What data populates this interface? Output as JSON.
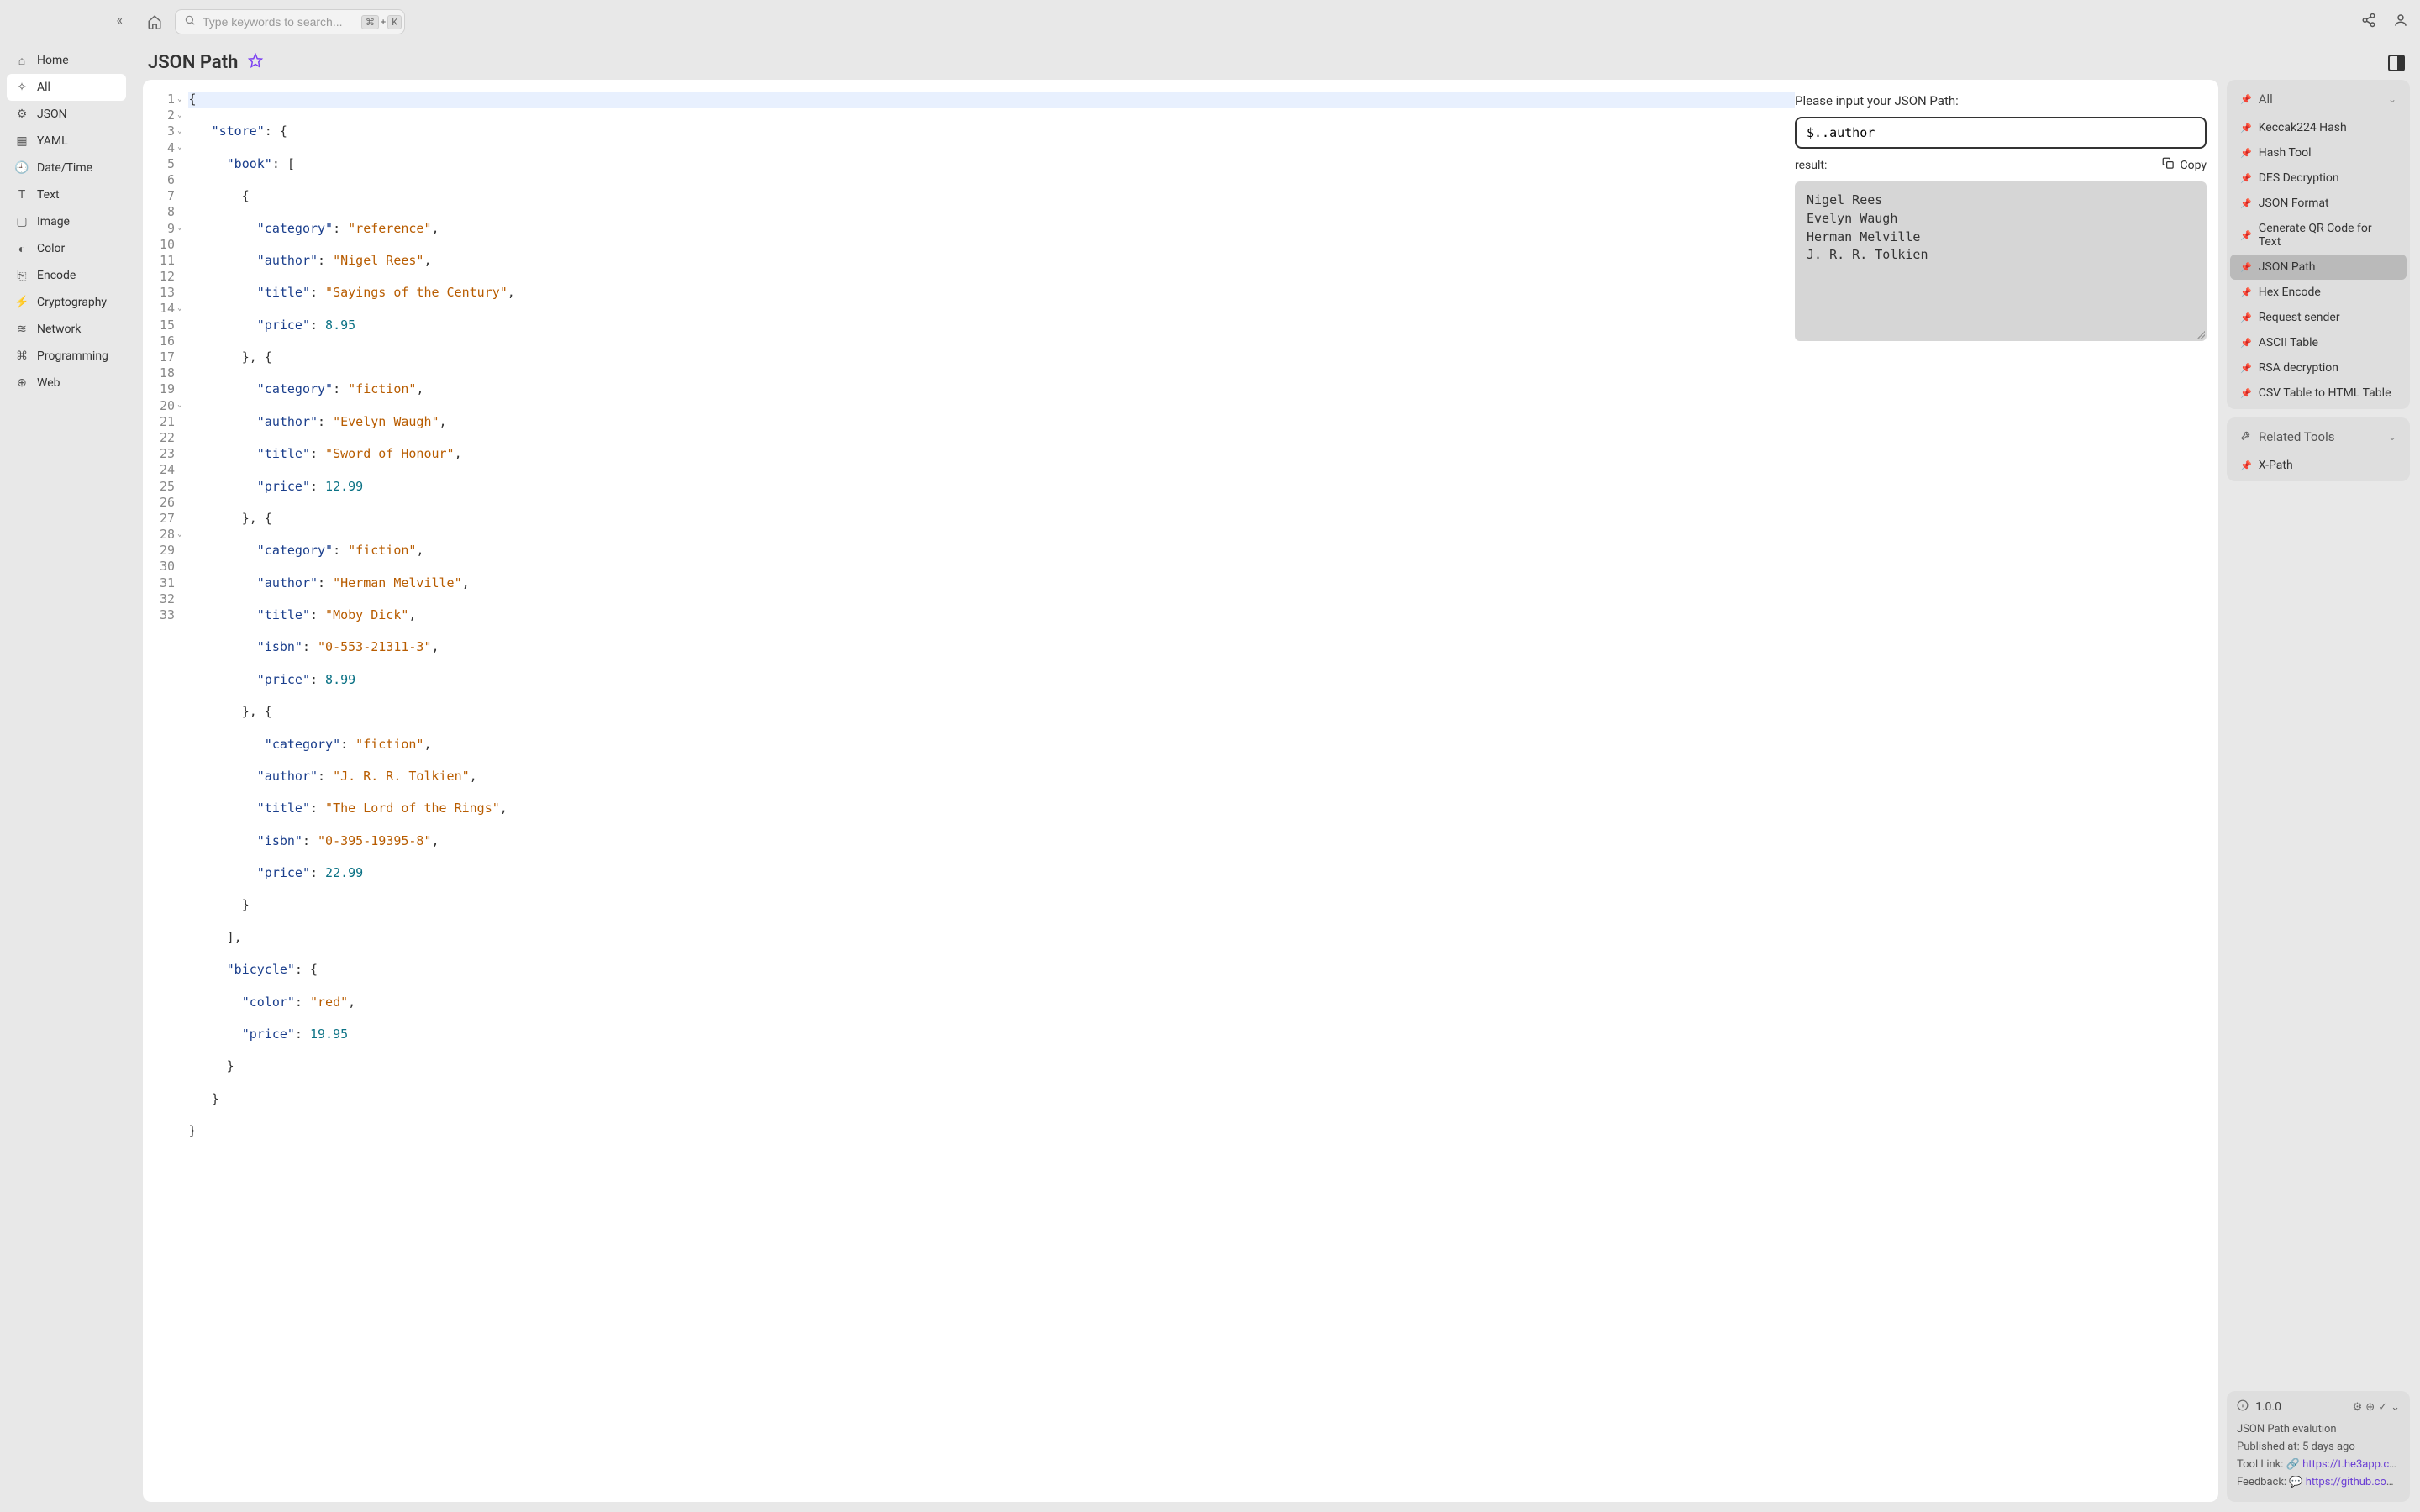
{
  "sidebar": {
    "collapse_icon": "«",
    "items": [
      {
        "icon": "⌂",
        "label": "Home"
      },
      {
        "icon": "✧",
        "label": "All"
      },
      {
        "icon": "⚙",
        "label": "JSON"
      },
      {
        "icon": "▦",
        "label": "YAML"
      },
      {
        "icon": "🕘",
        "label": "Date/Time"
      },
      {
        "icon": "T",
        "label": "Text"
      },
      {
        "icon": "▢",
        "label": "Image"
      },
      {
        "icon": "◐",
        "label": "Color"
      },
      {
        "icon": "⎘",
        "label": "Encode"
      },
      {
        "icon": "⚡",
        "label": "Cryptography"
      },
      {
        "icon": "≋",
        "label": "Network"
      },
      {
        "icon": "⌘",
        "label": "Programming"
      },
      {
        "icon": "⊕",
        "label": "Web"
      }
    ],
    "active_index": 1
  },
  "topbar": {
    "search_placeholder": "Type keywords to search...",
    "kbd1": "⌘",
    "kbd_plus": "+",
    "kbd2": "K"
  },
  "page": {
    "title": "JSON Path"
  },
  "editor": {
    "lines": [
      {
        "n": 1,
        "fold": true,
        "hl": true,
        "tokens": [
          {
            "t": "punct",
            "v": "{"
          }
        ]
      },
      {
        "n": 2,
        "fold": true,
        "tokens": [
          {
            "t": "pad",
            "v": "   "
          },
          {
            "t": "key",
            "v": "\"store\""
          },
          {
            "t": "punct",
            "v": ": {"
          }
        ]
      },
      {
        "n": 3,
        "fold": true,
        "tokens": [
          {
            "t": "pad",
            "v": "     "
          },
          {
            "t": "key",
            "v": "\"book\""
          },
          {
            "t": "punct",
            "v": ": ["
          }
        ]
      },
      {
        "n": 4,
        "fold": true,
        "tokens": [
          {
            "t": "pad",
            "v": "       "
          },
          {
            "t": "punct",
            "v": "{"
          }
        ]
      },
      {
        "n": 5,
        "tokens": [
          {
            "t": "pad",
            "v": "         "
          },
          {
            "t": "key",
            "v": "\"category\""
          },
          {
            "t": "punct",
            "v": ": "
          },
          {
            "t": "str",
            "v": "\"reference\""
          },
          {
            "t": "punct",
            "v": ","
          }
        ]
      },
      {
        "n": 6,
        "tokens": [
          {
            "t": "pad",
            "v": "         "
          },
          {
            "t": "key",
            "v": "\"author\""
          },
          {
            "t": "punct",
            "v": ": "
          },
          {
            "t": "str",
            "v": "\"Nigel Rees\""
          },
          {
            "t": "punct",
            "v": ","
          }
        ]
      },
      {
        "n": 7,
        "tokens": [
          {
            "t": "pad",
            "v": "         "
          },
          {
            "t": "key",
            "v": "\"title\""
          },
          {
            "t": "punct",
            "v": ": "
          },
          {
            "t": "str",
            "v": "\"Sayings of the Century\""
          },
          {
            "t": "punct",
            "v": ","
          }
        ]
      },
      {
        "n": 8,
        "tokens": [
          {
            "t": "pad",
            "v": "         "
          },
          {
            "t": "key",
            "v": "\"price\""
          },
          {
            "t": "punct",
            "v": ": "
          },
          {
            "t": "num",
            "v": "8.95"
          }
        ]
      },
      {
        "n": 9,
        "fold": true,
        "tokens": [
          {
            "t": "pad",
            "v": "       "
          },
          {
            "t": "punct",
            "v": "}, {"
          }
        ]
      },
      {
        "n": 10,
        "tokens": [
          {
            "t": "pad",
            "v": "         "
          },
          {
            "t": "key",
            "v": "\"category\""
          },
          {
            "t": "punct",
            "v": ": "
          },
          {
            "t": "str",
            "v": "\"fiction\""
          },
          {
            "t": "punct",
            "v": ","
          }
        ]
      },
      {
        "n": 11,
        "tokens": [
          {
            "t": "pad",
            "v": "         "
          },
          {
            "t": "key",
            "v": "\"author\""
          },
          {
            "t": "punct",
            "v": ": "
          },
          {
            "t": "str",
            "v": "\"Evelyn Waugh\""
          },
          {
            "t": "punct",
            "v": ","
          }
        ]
      },
      {
        "n": 12,
        "tokens": [
          {
            "t": "pad",
            "v": "         "
          },
          {
            "t": "key",
            "v": "\"title\""
          },
          {
            "t": "punct",
            "v": ": "
          },
          {
            "t": "str",
            "v": "\"Sword of Honour\""
          },
          {
            "t": "punct",
            "v": ","
          }
        ]
      },
      {
        "n": 13,
        "tokens": [
          {
            "t": "pad",
            "v": "         "
          },
          {
            "t": "key",
            "v": "\"price\""
          },
          {
            "t": "punct",
            "v": ": "
          },
          {
            "t": "num",
            "v": "12.99"
          }
        ]
      },
      {
        "n": 14,
        "fold": true,
        "tokens": [
          {
            "t": "pad",
            "v": "       "
          },
          {
            "t": "punct",
            "v": "}, {"
          }
        ]
      },
      {
        "n": 15,
        "tokens": [
          {
            "t": "pad",
            "v": "         "
          },
          {
            "t": "key",
            "v": "\"category\""
          },
          {
            "t": "punct",
            "v": ": "
          },
          {
            "t": "str",
            "v": "\"fiction\""
          },
          {
            "t": "punct",
            "v": ","
          }
        ]
      },
      {
        "n": 16,
        "tokens": [
          {
            "t": "pad",
            "v": "         "
          },
          {
            "t": "key",
            "v": "\"author\""
          },
          {
            "t": "punct",
            "v": ": "
          },
          {
            "t": "str",
            "v": "\"Herman Melville\""
          },
          {
            "t": "punct",
            "v": ","
          }
        ]
      },
      {
        "n": 17,
        "tokens": [
          {
            "t": "pad",
            "v": "         "
          },
          {
            "t": "key",
            "v": "\"title\""
          },
          {
            "t": "punct",
            "v": ": "
          },
          {
            "t": "str",
            "v": "\"Moby Dick\""
          },
          {
            "t": "punct",
            "v": ","
          }
        ]
      },
      {
        "n": 18,
        "tokens": [
          {
            "t": "pad",
            "v": "         "
          },
          {
            "t": "key",
            "v": "\"isbn\""
          },
          {
            "t": "punct",
            "v": ": "
          },
          {
            "t": "str",
            "v": "\"0-553-21311-3\""
          },
          {
            "t": "punct",
            "v": ","
          }
        ]
      },
      {
        "n": 19,
        "tokens": [
          {
            "t": "pad",
            "v": "         "
          },
          {
            "t": "key",
            "v": "\"price\""
          },
          {
            "t": "punct",
            "v": ": "
          },
          {
            "t": "num",
            "v": "8.99"
          }
        ]
      },
      {
        "n": 20,
        "fold": true,
        "tokens": [
          {
            "t": "pad",
            "v": "       "
          },
          {
            "t": "punct",
            "v": "}, {"
          }
        ]
      },
      {
        "n": 21,
        "tokens": [
          {
            "t": "pad",
            "v": "          "
          },
          {
            "t": "key",
            "v": "\"category\""
          },
          {
            "t": "punct",
            "v": ": "
          },
          {
            "t": "str",
            "v": "\"fiction\""
          },
          {
            "t": "punct",
            "v": ","
          }
        ]
      },
      {
        "n": 22,
        "tokens": [
          {
            "t": "pad",
            "v": "         "
          },
          {
            "t": "key",
            "v": "\"author\""
          },
          {
            "t": "punct",
            "v": ": "
          },
          {
            "t": "str",
            "v": "\"J. R. R. Tolkien\""
          },
          {
            "t": "punct",
            "v": ","
          }
        ]
      },
      {
        "n": 23,
        "tokens": [
          {
            "t": "pad",
            "v": "         "
          },
          {
            "t": "key",
            "v": "\"title\""
          },
          {
            "t": "punct",
            "v": ": "
          },
          {
            "t": "str",
            "v": "\"The Lord of the Rings\""
          },
          {
            "t": "punct",
            "v": ","
          }
        ]
      },
      {
        "n": 24,
        "tokens": [
          {
            "t": "pad",
            "v": "         "
          },
          {
            "t": "key",
            "v": "\"isbn\""
          },
          {
            "t": "punct",
            "v": ": "
          },
          {
            "t": "str",
            "v": "\"0-395-19395-8\""
          },
          {
            "t": "punct",
            "v": ","
          }
        ]
      },
      {
        "n": 25,
        "tokens": [
          {
            "t": "pad",
            "v": "         "
          },
          {
            "t": "key",
            "v": "\"price\""
          },
          {
            "t": "punct",
            "v": ": "
          },
          {
            "t": "num",
            "v": "22.99"
          }
        ]
      },
      {
        "n": 26,
        "tokens": [
          {
            "t": "pad",
            "v": "       "
          },
          {
            "t": "punct",
            "v": "}"
          }
        ]
      },
      {
        "n": 27,
        "tokens": [
          {
            "t": "pad",
            "v": "     "
          },
          {
            "t": "punct",
            "v": "],"
          }
        ]
      },
      {
        "n": 28,
        "fold": true,
        "tokens": [
          {
            "t": "pad",
            "v": "     "
          },
          {
            "t": "key",
            "v": "\"bicycle\""
          },
          {
            "t": "punct",
            "v": ": {"
          }
        ]
      },
      {
        "n": 29,
        "tokens": [
          {
            "t": "pad",
            "v": "       "
          },
          {
            "t": "key",
            "v": "\"color\""
          },
          {
            "t": "punct",
            "v": ": "
          },
          {
            "t": "str",
            "v": "\"red\""
          },
          {
            "t": "punct",
            "v": ","
          }
        ]
      },
      {
        "n": 30,
        "tokens": [
          {
            "t": "pad",
            "v": "       "
          },
          {
            "t": "key",
            "v": "\"price\""
          },
          {
            "t": "punct",
            "v": ": "
          },
          {
            "t": "num",
            "v": "19.95"
          }
        ]
      },
      {
        "n": 31,
        "tokens": [
          {
            "t": "pad",
            "v": "     "
          },
          {
            "t": "punct",
            "v": "}"
          }
        ]
      },
      {
        "n": 32,
        "tokens": [
          {
            "t": "pad",
            "v": "   "
          },
          {
            "t": "punct",
            "v": "}"
          }
        ]
      },
      {
        "n": 33,
        "tokens": [
          {
            "t": "punct",
            "v": "}"
          }
        ]
      }
    ]
  },
  "jsonpath": {
    "input_label": "Please input your JSON Path:",
    "input_value": "$..author",
    "result_label": "result:",
    "copy_label": "Copy",
    "result_text": "Nigel Rees\nEvelyn Waugh\nHerman Melville\nJ. R. R. Tolkien"
  },
  "right_panels": {
    "all": {
      "title": "All",
      "items": [
        "Keccak224 Hash",
        "Hash Tool",
        "DES Decryption",
        "JSON Format",
        "Generate QR Code for Text",
        "JSON Path",
        "Hex Encode",
        "Request sender",
        "ASCII Table",
        "RSA decryption",
        "CSV Table to HTML Table"
      ],
      "active_index": 5
    },
    "related": {
      "title": "Related Tools",
      "items": [
        "X-Path"
      ]
    }
  },
  "info": {
    "version": "1.0.0",
    "desc": "JSON Path evalution",
    "published_label": "Published at:",
    "published_value": "5 days ago",
    "tool_link_label": "Tool Link:",
    "tool_link_value": "https://t.he3app.co…",
    "feedback_label": "Feedback:",
    "feedback_value": "https://github.com/…"
  }
}
